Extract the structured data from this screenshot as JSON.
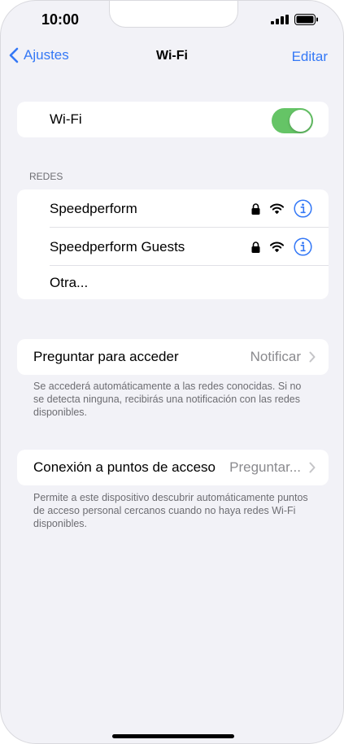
{
  "status_bar": {
    "time": "10:00",
    "icons": [
      "cellular-signal-icon",
      "battery-icon"
    ]
  },
  "nav": {
    "back_label": "Ajustes",
    "title": "Wi-Fi",
    "edit_label": "Editar"
  },
  "wifi_toggle": {
    "label": "Wi-Fi",
    "enabled": true,
    "on_color": "#65c466"
  },
  "networks": {
    "header": "REDES",
    "items": [
      {
        "name": "Speedperform",
        "secured": true,
        "icons": [
          "lock-icon",
          "wifi-signal-icon",
          "info-icon"
        ]
      },
      {
        "name": "Speedperform Guests",
        "secured": true,
        "icons": [
          "lock-icon",
          "wifi-signal-icon",
          "info-icon"
        ]
      },
      {
        "name": "Otra..."
      }
    ]
  },
  "ask_to_join": {
    "label": "Preguntar para acceder",
    "value": "Notificar",
    "footer": "Se accederá automáticamente a las redes conocidas. Si no se detecta ninguna, recibirás una notificación con las redes disponibles."
  },
  "hotspot": {
    "label": "Conexión a puntos de acceso",
    "value": "Preguntar...",
    "footer": "Permite a este dispositivo descubrir automáticamente puntos de acceso personal cercanos cuando no haya redes Wi-Fi disponibles."
  },
  "colors": {
    "accent": "#3478f6",
    "background": "#f2f2f7",
    "secondary_text": "#8a8a8e"
  }
}
